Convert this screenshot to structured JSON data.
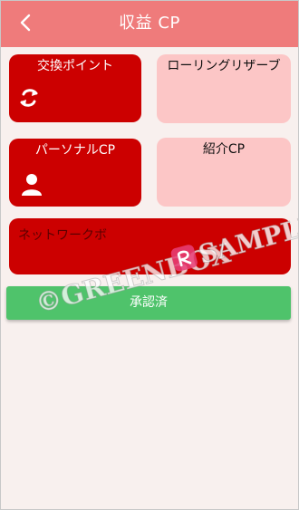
{
  "header": {
    "title": "収益 CP",
    "back_icon": "chevron-left-icon"
  },
  "cards": {
    "exchange": {
      "label": "交換ポイント",
      "icon": "exchange-arrows-icon"
    },
    "rolling": {
      "label": "ローリングリザーブ"
    },
    "personal": {
      "label": "パーソナルCP",
      "icon": "person-icon"
    },
    "referral": {
      "label": "紹介CP"
    },
    "network": {
      "label": "ネットワークボ"
    }
  },
  "approve_button": {
    "label": "承認済"
  },
  "watermark": {
    "left_text": "©GREENBOX",
    "right_text": "SAMPLE"
  },
  "colors": {
    "header": "#ef7b7b",
    "card_red": "#cc0000",
    "card_pink": "#fcc6c6",
    "button_green": "#4fc36b",
    "background": "#f8f0ee"
  }
}
